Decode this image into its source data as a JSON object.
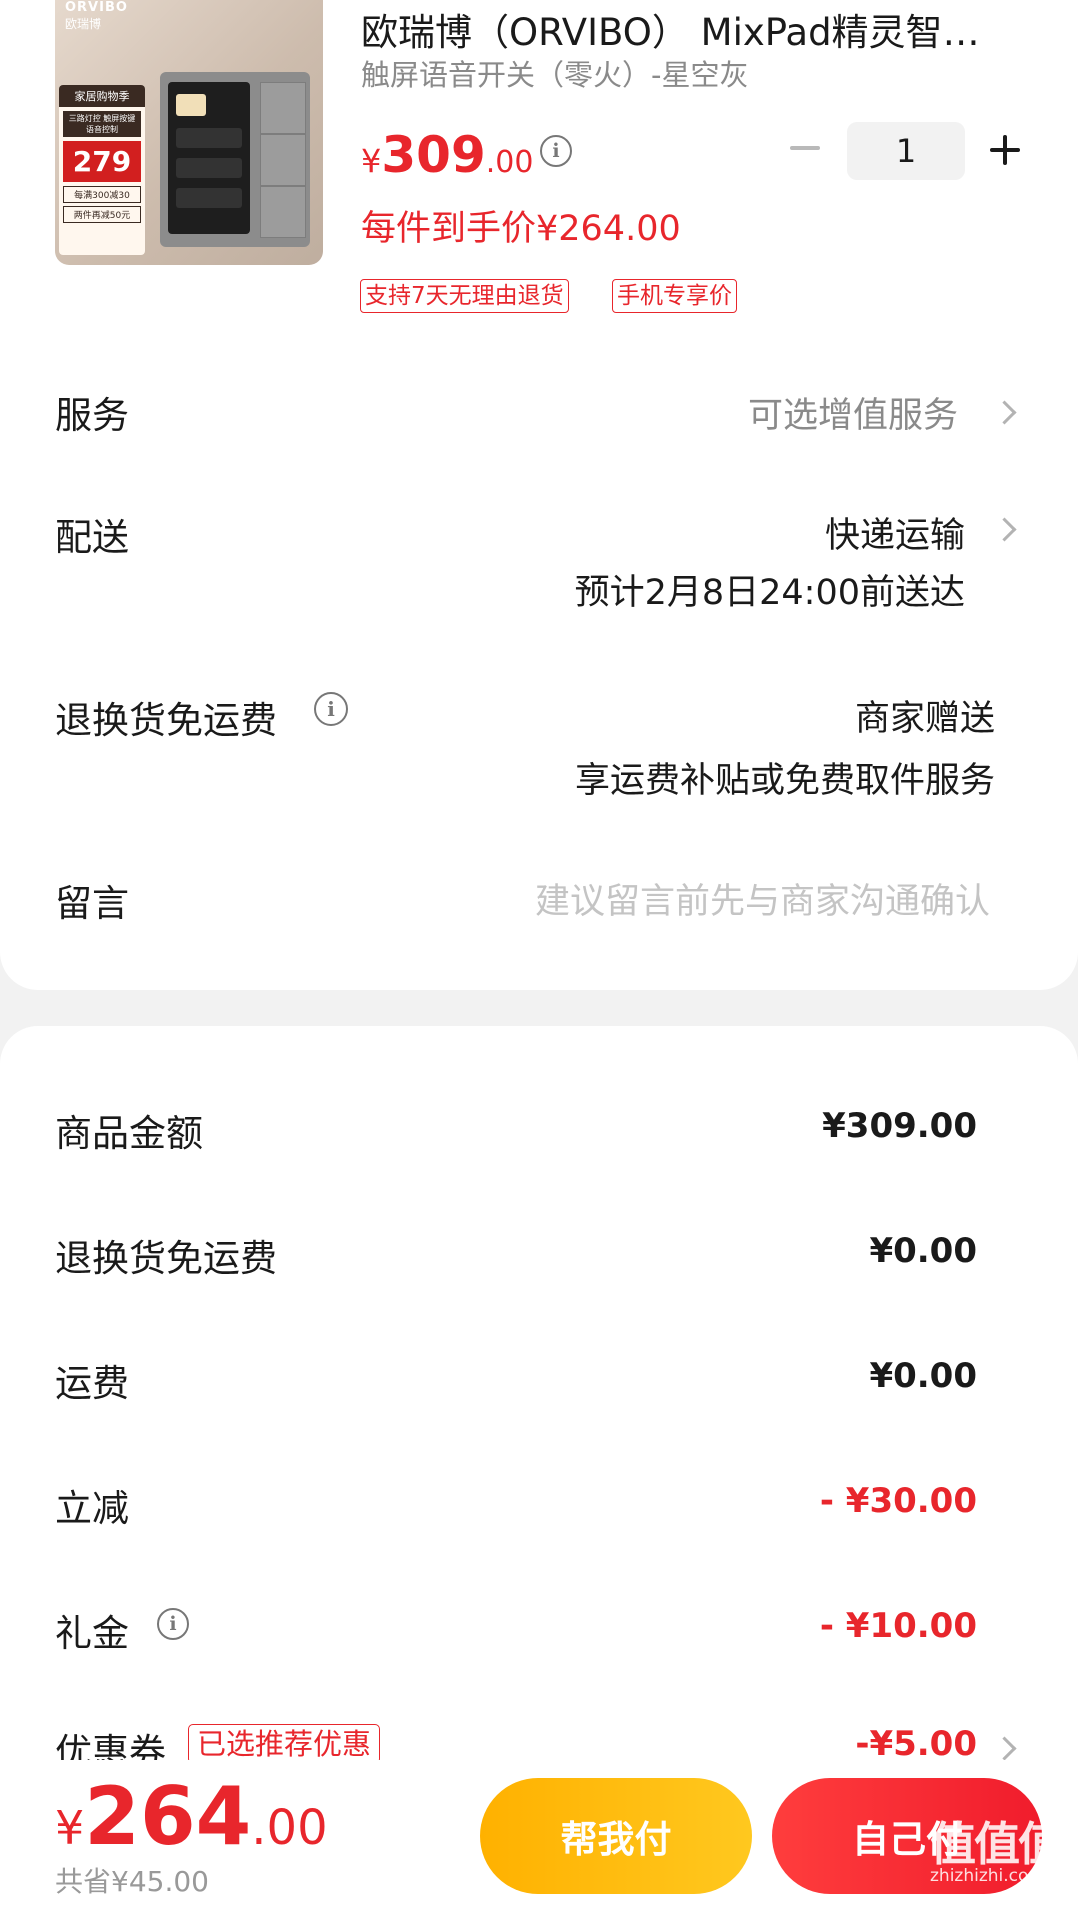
{
  "product": {
    "image_brand": "ORVIBO",
    "image_brand_cn": "欧瑞博",
    "image_promo_title": "家居购物季",
    "image_promo_sub": "三路灯控 触屏按键语音控制",
    "image_promo_price": "279",
    "image_promo_line1": "每满300减30",
    "image_promo_line2": "两件再减50元",
    "title": "欧瑞博（ORVIBO） MixPad精灵智能开关面板",
    "subtitle": "触屏语音开关（零火）-星空灰",
    "price_symbol": "¥",
    "price_int": "309",
    "price_dec": ".00",
    "unit_price": "每件到手价¥264.00",
    "quantity": "1",
    "tags": [
      "支持7天无理由退货",
      "手机专享价"
    ]
  },
  "options": {
    "service_label": "服务",
    "service_value": "可选增值服务",
    "delivery_label": "配送",
    "delivery_value": "快递运输",
    "delivery_eta": "预计2月8日24:00前送达",
    "return_label": "退换货免运费",
    "return_value": "商家赠送",
    "return_desc": "享运费补贴或免费取件服务",
    "note_label": "留言",
    "note_placeholder": "建议留言前先与商家沟通确认"
  },
  "summary": {
    "rows": [
      {
        "label": "商品金额",
        "value": "¥309.00"
      },
      {
        "label": "退换货免运费",
        "value": "¥0.00"
      },
      {
        "label": "运费",
        "value": "¥0.00"
      },
      {
        "label": "立减",
        "value": "- ¥30.00"
      },
      {
        "label": "礼金",
        "value": "- ¥10.00"
      },
      {
        "label": "优惠券",
        "value": "-¥5.00"
      }
    ],
    "coupon_tag": "已选推荐优惠"
  },
  "footer": {
    "total_symbol": "¥",
    "total_int": "264",
    "total_dec": ".00",
    "saved": "共省¥45.00",
    "help_pay": "帮我付",
    "self_pay": "自己付",
    "watermark": "值值值",
    "watermark_url": "zhizhizhi.com"
  },
  "colors": {
    "accent_red": "#e8262c",
    "help_button": "#ffb100",
    "pay_button": "#f01c2c"
  }
}
